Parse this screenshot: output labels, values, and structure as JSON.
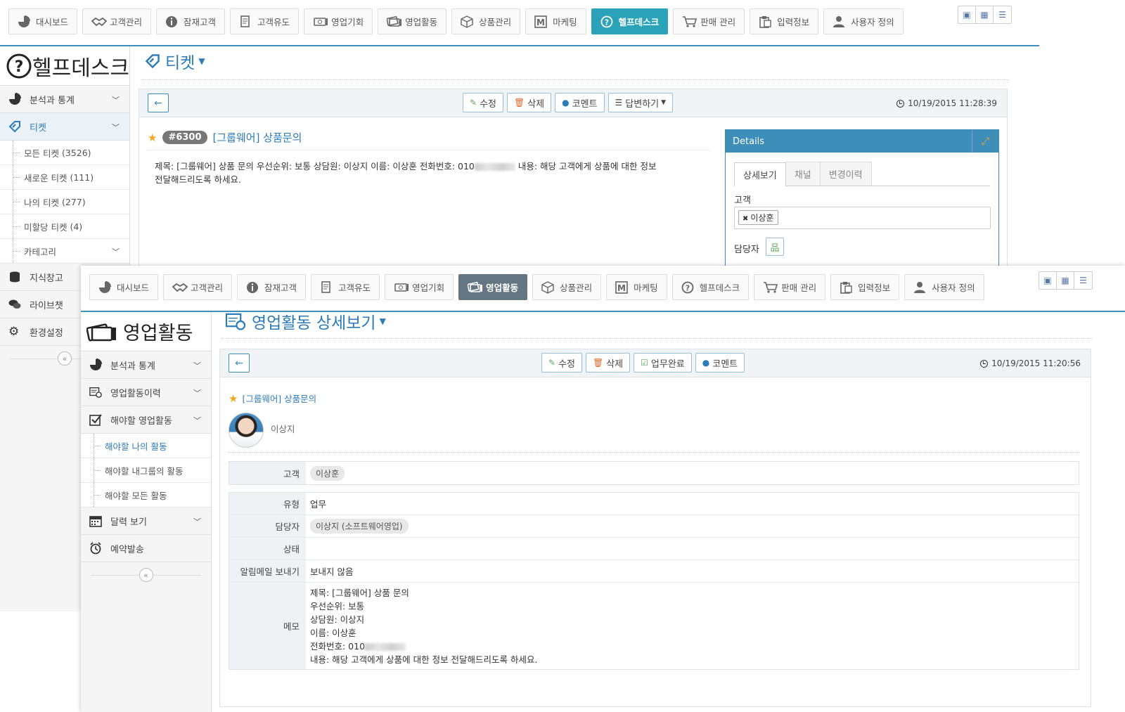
{
  "back_window": {
    "topnav": [
      {
        "label": "대시보드",
        "icon": "pie-chart-icon"
      },
      {
        "label": "고객관리",
        "icon": "handshake-icon"
      },
      {
        "label": "잠재고객",
        "icon": "info-icon"
      },
      {
        "label": "고객유도",
        "icon": "document-icon"
      },
      {
        "label": "영업기회",
        "icon": "money-icon"
      },
      {
        "label": "영업활동",
        "icon": "money-stack-icon"
      },
      {
        "label": "상품관리",
        "icon": "box-icon"
      },
      {
        "label": "마케팅",
        "icon": "m-logo-icon"
      },
      {
        "label": "헬프데스크",
        "icon": "help-icon",
        "active": true
      },
      {
        "label": "판매 관리",
        "icon": "cart-icon"
      },
      {
        "label": "입력정보",
        "icon": "clipboard-icon"
      },
      {
        "label": "사용자 정의",
        "icon": "user-icon"
      }
    ],
    "sidebar": {
      "title": "헬프데스크",
      "items": [
        {
          "label": "분석과 통계"
        },
        {
          "label": "티켓"
        },
        {
          "label": "지식창고"
        },
        {
          "label": "라이브챗"
        },
        {
          "label": "환경설정"
        }
      ],
      "ticket_sub": [
        {
          "label": "모든 티켓",
          "count": "(3526)"
        },
        {
          "label": "새로운 티켓",
          "count": "(111)"
        },
        {
          "label": "나의 티켓",
          "count": "(277)"
        },
        {
          "label": "미할당 티켓",
          "count": "(4)"
        },
        {
          "label": "카테고리"
        }
      ]
    },
    "page_title": "티켓",
    "actions": {
      "edit": "수정",
      "delete": "삭제",
      "comment": "코멘트",
      "reply": "답변하기"
    },
    "timestamp": "10/19/2015 11:28:39",
    "ticket": {
      "number": "#6300",
      "subject": "[그룹웨어] 상품문의",
      "body_line1": "제목: [그룹웨어] 상품 문의 우선순위: 보통 상담원: 이상지 이름: 이상훈 전화번호: 010",
      "body_line1b": "내용: 해당 고객에게 상품에 대한 정보",
      "body_line2": "전달해드리도록 하세요."
    },
    "details": {
      "header": "Details",
      "tabs": [
        "상세보기",
        "채널",
        "변경이력"
      ],
      "customer_label": "고객",
      "customer_value": "이상훈",
      "assignee_label": "담당자"
    }
  },
  "front_window": {
    "topnav": [
      {
        "label": "대시보드",
        "icon": "pie-chart-icon"
      },
      {
        "label": "고객관리",
        "icon": "handshake-icon"
      },
      {
        "label": "잠재고객",
        "icon": "info-icon"
      },
      {
        "label": "고객유도",
        "icon": "document-icon"
      },
      {
        "label": "영업기회",
        "icon": "money-icon"
      },
      {
        "label": "영업활동",
        "icon": "money-stack-icon",
        "active": true
      },
      {
        "label": "상품관리",
        "icon": "box-icon"
      },
      {
        "label": "마케팅",
        "icon": "m-logo-icon"
      },
      {
        "label": "헬프데스크",
        "icon": "help-icon"
      },
      {
        "label": "판매 관리",
        "icon": "cart-icon"
      },
      {
        "label": "입력정보",
        "icon": "clipboard-icon"
      },
      {
        "label": "사용자 정의",
        "icon": "user-icon"
      }
    ],
    "sidebar": {
      "title": "영업활동",
      "items": [
        {
          "label": "분석과 통계"
        },
        {
          "label": "영업활동이력"
        },
        {
          "label": "해야할 영업활동"
        },
        {
          "label": "달력 보기"
        },
        {
          "label": "예약발송"
        }
      ],
      "todo_sub": [
        {
          "label": "해야할 나의 활동"
        },
        {
          "label": "해야할 내그룹의 활동"
        },
        {
          "label": "해야할 모든 활동"
        }
      ]
    },
    "page_title": "영업활동 상세보기",
    "actions": {
      "edit": "수정",
      "delete": "삭제",
      "done": "업무완료",
      "comment": "코멘트"
    },
    "timestamp": "10/19/2015 11:20:56",
    "activity": {
      "subject": "[그룹웨어] 상품문의",
      "owner": "이상지"
    },
    "customer_row": {
      "label": "고객",
      "value": "이상훈"
    },
    "rows": {
      "type_label": "유형",
      "type_value": "업무",
      "assignee_label": "담당자",
      "assignee_value": "이상지 (소프트웨어영업)",
      "status_label": "상태",
      "status_value": "",
      "mail_label": "알림메일 보내기",
      "mail_value": "보내지 않음",
      "memo_label": "메모",
      "memo_lines": [
        "제목: [그룹웨어] 상품 문의",
        "우선순위: 보통",
        "상담원: 이상지",
        "이름: 이상훈",
        "전화번호: 010",
        "내용: 해당 고객에게 상품에 대한 정보 전달해드리도록 하세요."
      ]
    }
  }
}
